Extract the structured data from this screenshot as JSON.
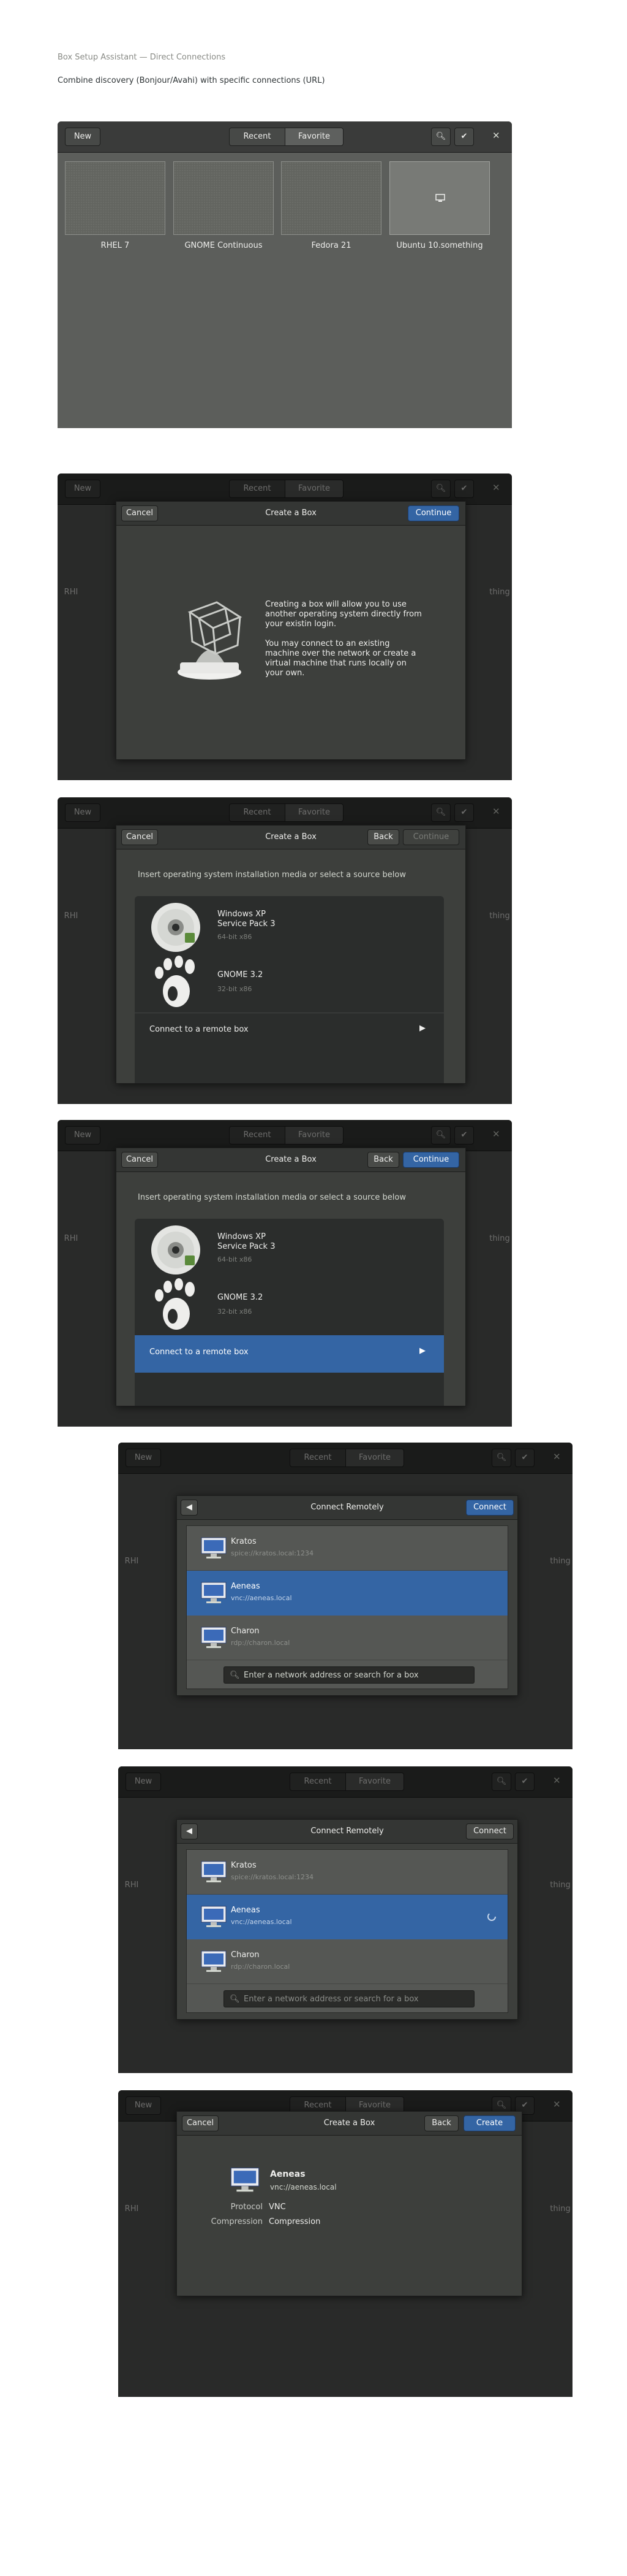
{
  "page": {
    "title": "Box Setup Assistant — Direct Connections",
    "subtitle": "Combine discovery (Bonjour/Avahi) with specific connections (URL)"
  },
  "toolbar": {
    "new_label": "New",
    "recent_label": "Recent",
    "favorite_label": "Favorite",
    "search_icon": "search-icon",
    "select_icon": "checkmark-icon",
    "close_icon": "close-icon"
  },
  "collection": [
    {
      "label": "RHEL 7"
    },
    {
      "label": "GNOME Continuous"
    },
    {
      "label": "Fedora 21"
    },
    {
      "label": "Ubuntu 10.something",
      "selected": true
    }
  ],
  "bg_labels": {
    "left": "RHI",
    "right": "thing"
  },
  "create_box": {
    "title": "Create a Box",
    "cancel": "Cancel",
    "continue": "Continue",
    "back": "Back",
    "intro_p1": "Creating a box will allow you to use another operating system directly from your existin login.",
    "intro_p2": "You may connect to an existing machine over the network or create a virtual machine that runs locally on your own.",
    "source_heading": "Insert operating system installation media or select a source below",
    "sources": [
      {
        "name": "Windows XP",
        "detail": "Service Pack 3",
        "size": "64-bit x86",
        "icon": "cd-icon"
      },
      {
        "name": "GNOME 3.2",
        "detail": "",
        "size": "32-bit x86",
        "icon": "gnome-foot-icon"
      }
    ],
    "remote_label": "Connect to a remote box"
  },
  "connect_remotely": {
    "title": "Connect Remotely",
    "connect": "Connect",
    "back_icon": "chevron-left-icon",
    "search_placeholder": "Enter a network address or search for a box",
    "boxes": [
      {
        "name": "Kratos",
        "url": "spice://kratos.local:1234"
      },
      {
        "name": "Aeneas",
        "url": "vnc://aeneas.local"
      },
      {
        "name": "Charon",
        "url": "rdp://charon.local"
      }
    ]
  },
  "review": {
    "title": "Create a Box",
    "cancel": "Cancel",
    "back": "Back",
    "create": "Create",
    "name": "Aeneas",
    "url": "vnc://aeneas.local",
    "protocol_key": "Protocol",
    "protocol_value": "VNC",
    "compression_key": "Compression",
    "compression_value": "Compression"
  },
  "colors": {
    "accent": "#3465a4",
    "window_bg": "#2f302f",
    "content_bg": "#5c5e5b"
  }
}
